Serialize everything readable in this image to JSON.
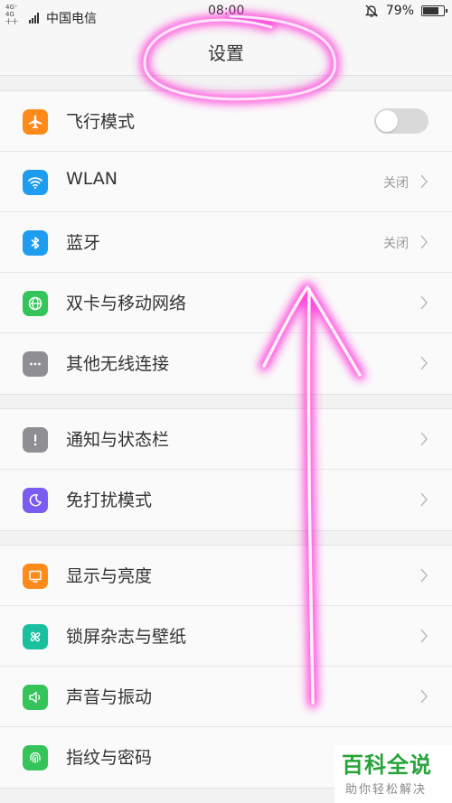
{
  "status_bar": {
    "network_top": "4G⁺ 4G",
    "network_bottom": "十十 2G",
    "carrier": "中国电信",
    "time": "08:00",
    "battery_percent": "79%",
    "battery_level": 0.79
  },
  "header": {
    "title": "设置"
  },
  "groups": [
    {
      "items": [
        {
          "label": "飞行模式",
          "icon": "airplane-icon",
          "color": "#ff8a1c",
          "control": "toggle",
          "toggle_on": false
        },
        {
          "label": "WLAN",
          "icon": "wifi-icon",
          "color": "#1e9cf0",
          "status": "关闭"
        },
        {
          "label": "蓝牙",
          "icon": "bluetooth-icon",
          "color": "#1e9cf0",
          "status": "关闭"
        },
        {
          "label": "双卡与移动网络",
          "icon": "globe-icon",
          "color": "#35c45a"
        },
        {
          "label": "其他无线连接",
          "icon": "more-icon",
          "color": "#8e8e93"
        }
      ]
    },
    {
      "items": [
        {
          "label": "通知与状态栏",
          "icon": "notification-icon",
          "color": "#8e8e93"
        },
        {
          "label": "免打扰模式",
          "icon": "moon-icon",
          "color": "#7b5cf0"
        }
      ]
    },
    {
      "items": [
        {
          "label": "显示与亮度",
          "icon": "display-icon",
          "color": "#ff8a1c"
        },
        {
          "label": "锁屏杂志与壁纸",
          "icon": "pinwheel-icon",
          "color": "#19c0a0"
        },
        {
          "label": "声音与振动",
          "icon": "speaker-icon",
          "color": "#35c45a"
        },
        {
          "label": "指纹与密码",
          "icon": "fingerprint-icon",
          "color": "#35c45a"
        }
      ]
    }
  ],
  "watermark": {
    "main": "百科全说",
    "sub": "助你轻松解决"
  },
  "colors": {
    "annotation": "#ff2bd6",
    "background": "#f2f2f2",
    "row": "#fafafa"
  }
}
